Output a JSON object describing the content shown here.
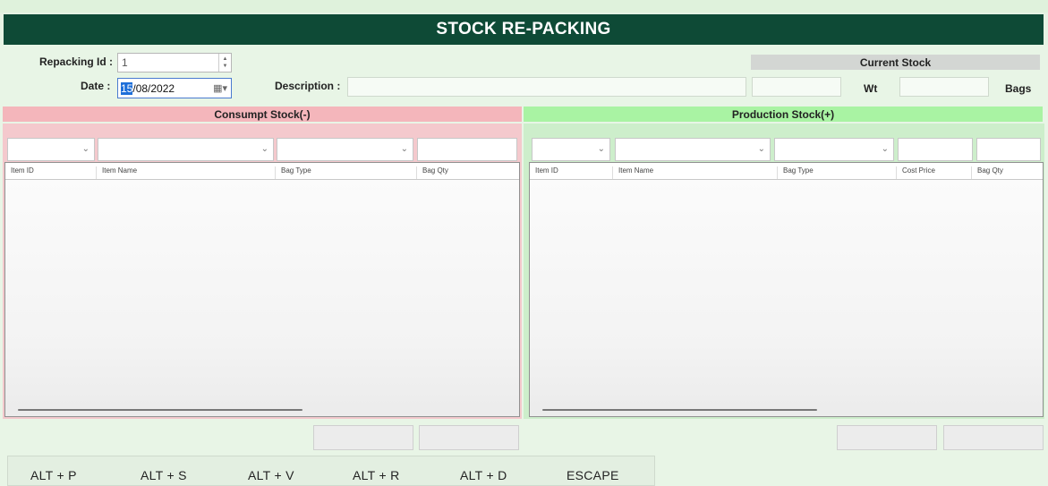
{
  "title": "STOCK RE-PACKING",
  "header": {
    "repacking_id_label": "Repacking Id :",
    "repacking_id_value": "1",
    "date_label": "Date :",
    "date_day_selected": "15",
    "date_rest": "/08/2022",
    "description_label": "Description :",
    "description_value": "",
    "current_stock_label": "Current Stock",
    "wt_label": "Wt",
    "bags_label": "Bags"
  },
  "consumpt": {
    "title": "Consumpt Stock(-)",
    "columns": [
      "Item ID",
      "Item Name",
      "Bag Type",
      "Bag Qty"
    ]
  },
  "production": {
    "title": "Production Stock(+)",
    "columns": [
      "Item ID",
      "Item Name",
      "Bag Type",
      "Cost Price",
      "Bag Qty"
    ]
  },
  "shortcuts": [
    "ALT + P",
    "ALT + S",
    "ALT + V",
    "ALT + R",
    "ALT + D",
    "ESCAPE"
  ],
  "colors": {
    "title_bar": "#0e4a36",
    "consumpt_header": "#f4b6bb",
    "production_header": "#a9f3a3",
    "background": "#e8f5e6"
  }
}
